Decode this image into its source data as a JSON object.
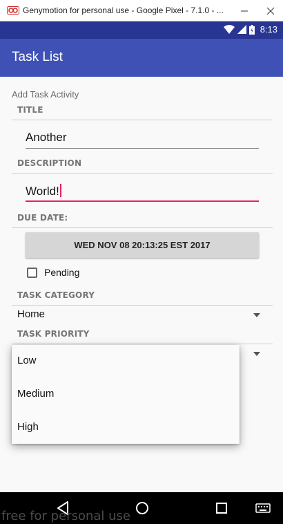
{
  "window": {
    "title": "Genymotion for personal use - Google Pixel - 7.1.0 - ...",
    "watermark": "free for personal use"
  },
  "status_bar": {
    "time": "8:13",
    "icons": [
      "wifi-icon",
      "signal-icon",
      "battery-icon"
    ]
  },
  "app_bar": {
    "title": "Task List"
  },
  "form": {
    "activity_label": "Add Task Activity",
    "title_header": "TITLE",
    "title_value": "Another",
    "description_header": "DESCRIPTION",
    "description_value": "World!",
    "due_date_header": "DUE DATE:",
    "due_date_button": "WED NOV 08 20:13:25 EST 2017",
    "pending_label": "Pending",
    "pending_checked": false,
    "category_header": "TASK CATEGORY",
    "category_value": "Home",
    "priority_header": "TASK PRIORITY"
  },
  "priority_popup": {
    "options": [
      "Low",
      "Medium",
      "High"
    ]
  },
  "colors": {
    "status_bar": "#283593",
    "app_bar": "#3f51b5",
    "accent": "#e91e63"
  }
}
